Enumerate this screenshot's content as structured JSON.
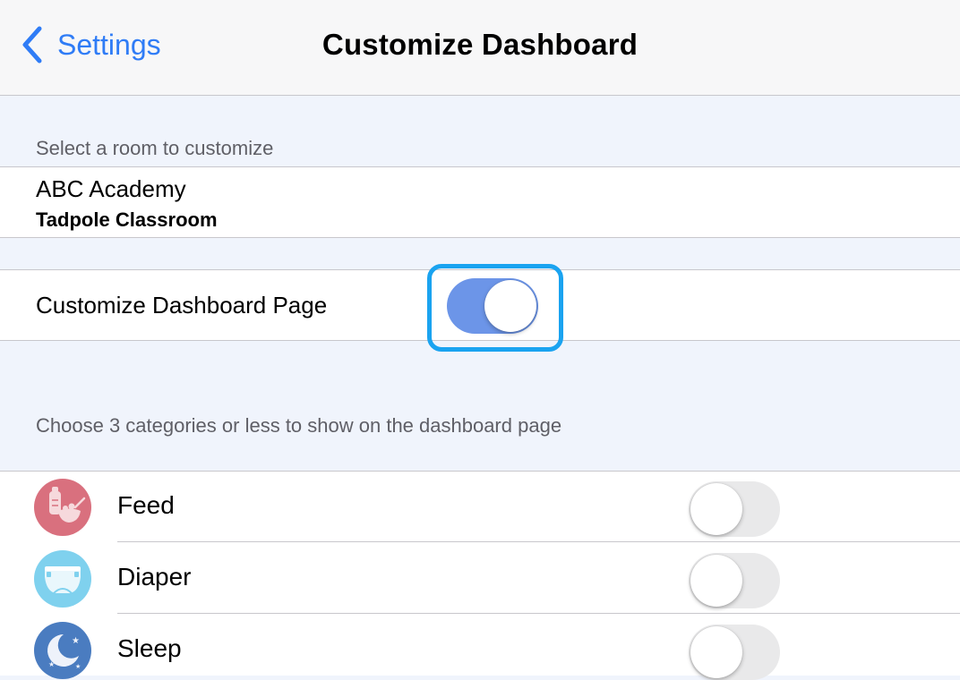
{
  "navbar": {
    "back_label": "Settings",
    "title": "Customize Dashboard"
  },
  "room_section": {
    "header": "Select a room to customize",
    "room_name": "ABC Academy",
    "room_sub": "Tadpole Classroom"
  },
  "customize": {
    "label": "Customize Dashboard Page",
    "enabled": true
  },
  "categories_section": {
    "header": "Choose 3 categories or less to show on the dashboard page",
    "items": [
      {
        "label": "Feed",
        "icon": "feed-icon",
        "enabled": false,
        "color": "#d9707e"
      },
      {
        "label": "Diaper",
        "icon": "diaper-icon",
        "enabled": false,
        "color": "#7fd1ee"
      },
      {
        "label": "Sleep",
        "icon": "sleep-icon",
        "enabled": false,
        "color": "#4a7cc0"
      }
    ]
  },
  "colors": {
    "accent": "#2f7cf6",
    "switch_on": "#6c95e8",
    "highlight": "#1aa3f0"
  }
}
